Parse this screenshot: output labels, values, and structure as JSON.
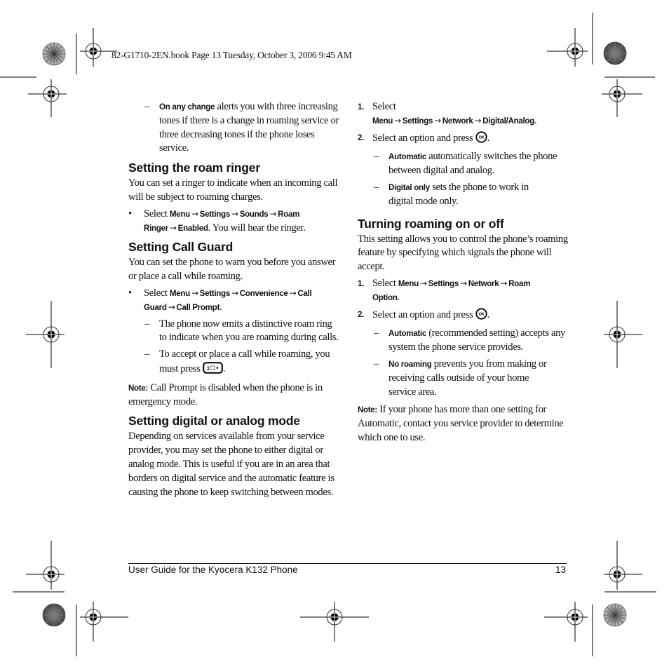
{
  "slug": "82-G1710-2EN.book  Page 13  Tuesday, October 3, 2006  9:45 AM",
  "arrow": "→",
  "left_column": {
    "intro_dash": {
      "keyword": "On any change",
      "text": " alerts you with three increasing tones if there is a change in roaming service or three decreasing tones if the phone loses service."
    },
    "roam_ringer": {
      "heading": "Setting the roam ringer",
      "body": "You can set a ringer to indicate when an incoming call will be subject to roaming charges.",
      "bullet": {
        "prefix": "Select ",
        "path": [
          "Menu",
          "Settings",
          "Sounds",
          "Roam Ringer",
          "Enabled"
        ],
        "suffix": ". You will hear the ringer."
      }
    },
    "call_guard": {
      "heading": "Setting Call Guard",
      "body": "You can set the phone to warn you before you answer or place a call while roaming.",
      "bullet": {
        "prefix": "Select ",
        "path": [
          "Menu",
          "Settings",
          "Convenience",
          "Call Guard",
          "Call Prompt"
        ],
        "suffix": "."
      },
      "dash1": "The phone now emits a distinctive roam ring to indicate when you are roaming during calls.",
      "dash2_prefix": "To accept or place a call while roaming, you must press",
      "dash2_suffix": ".",
      "note_label": "Note:",
      "note_text": "Call Prompt is disabled when the phone is in emergency mode."
    },
    "digital_analog": {
      "heading": "Setting digital or analog mode",
      "body": "Depending on services available from your service provider, you may set the phone to either digital or analog mode. This is useful if you are in an area that borders on digital service and the automatic feature is causing the phone to keep switching between modes."
    }
  },
  "right_column": {
    "digital_steps": {
      "step1_num": "1.",
      "step1_prefix": "Select ",
      "step1_path": [
        "Menu",
        "Settings",
        "Network",
        "Digital/Analog"
      ],
      "step1_suffix": ".",
      "step2_num": "2.",
      "step2_text": "Select an option and press",
      "step2_suffix": ".",
      "opt1_keyword": "Automatic",
      "opt1_text": " automatically switches the phone between digital and analog.",
      "opt2_keyword": "Digital only",
      "opt2_text": " sets the phone to work in digital mode only."
    },
    "roaming": {
      "heading": "Turning roaming on or off",
      "body": "This setting allows you to control the phone’s roaming feature by specifying which signals the phone will accept.",
      "step1_num": "1.",
      "step1_prefix": "Select ",
      "step1_path": [
        "Menu",
        "Settings",
        "Network",
        "Roam Option"
      ],
      "step1_suffix": ".",
      "step2_num": "2.",
      "step2_text": "Select an option and press",
      "step2_suffix": ".",
      "opt1_keyword": "Automatic",
      "opt1_text": " (recommended setting) accepts any system the phone service provides.",
      "opt2_keyword": "No roaming",
      "opt2_text": " prevents you from making or receiving calls outside of your home service area.",
      "note_label": "Note:",
      "note_text": "If your phone has more than one setting for Automatic, contact you service provider to determine which one to use."
    }
  },
  "icons": {
    "send_key": "send-key-icon",
    "ok_key": "ok-key-icon",
    "registration_mark": "registration-mark-icon",
    "color_target": "color-target-icon"
  },
  "footer": {
    "title": "User Guide for the Kyocera K132 Phone",
    "page_number": "13"
  }
}
